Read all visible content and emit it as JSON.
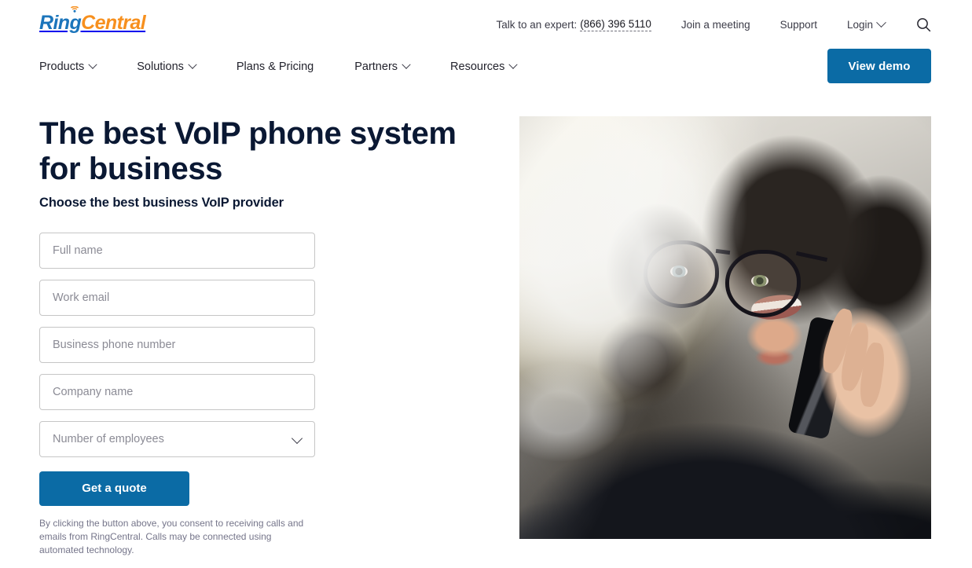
{
  "brand": {
    "logo_ring": "Ring",
    "logo_central": "Central",
    "logo_alt": "RingCentral",
    "blue": "#1b75bb",
    "orange": "#f7901e",
    "accent_button": "#0b6ba5",
    "heading_navy": "#0a1833"
  },
  "topbar": {
    "expert_label": "Talk to an expert:",
    "phone": "(866) 396 5110",
    "links": [
      {
        "label": "Join a meeting",
        "has_chevron": false
      },
      {
        "label": "Support",
        "has_chevron": false
      },
      {
        "label": "Login",
        "has_chevron": true
      }
    ],
    "search_icon": "search-icon"
  },
  "nav": {
    "items": [
      {
        "label": "Products",
        "has_chevron": true
      },
      {
        "label": "Solutions",
        "has_chevron": true
      },
      {
        "label": "Plans & Pricing",
        "has_chevron": false
      },
      {
        "label": "Partners",
        "has_chevron": true
      },
      {
        "label": "Resources",
        "has_chevron": true
      }
    ],
    "cta_label": "View demo"
  },
  "hero": {
    "title_line1": "The best VoIP phone system",
    "title_line2": "for business",
    "subtitle": "Choose the best business VoIP provider",
    "image_alt": "Woman with glasses talking on a mobile phone seen through a window"
  },
  "form": {
    "fields": [
      {
        "name": "full-name",
        "placeholder": "Full name",
        "value": "",
        "type": "text"
      },
      {
        "name": "work-email",
        "placeholder": "Work email",
        "value": "",
        "type": "email"
      },
      {
        "name": "business-phone",
        "placeholder": "Business phone number",
        "value": "",
        "type": "tel"
      },
      {
        "name": "company-name",
        "placeholder": "Company name",
        "value": "",
        "type": "text"
      }
    ],
    "employees_select": {
      "placeholder": "Number of employees",
      "selected": "Number of employees",
      "chevron_icon": "chevron-down-icon"
    },
    "submit_label": "Get a quote",
    "disclaimer": "By clicking the button above, you consent to receiving calls and emails from RingCentral. Calls may be connected using automated technology."
  }
}
